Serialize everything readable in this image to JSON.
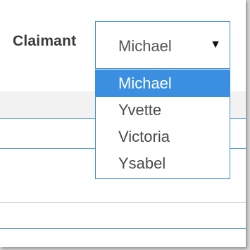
{
  "form": {
    "claimant_label": "Claimant",
    "select": {
      "selected_value": "Michael",
      "arrow_glyph": "▼",
      "arrow_icon": "triangle-down-icon"
    },
    "options": [
      "Michael",
      "Yvette",
      "Victoria",
      "Ysabel"
    ],
    "highlighted_option": "Michael"
  },
  "colors": {
    "accent": "#3b8fe0",
    "border": "#3d8ed4",
    "label": "#3a3a3a"
  }
}
